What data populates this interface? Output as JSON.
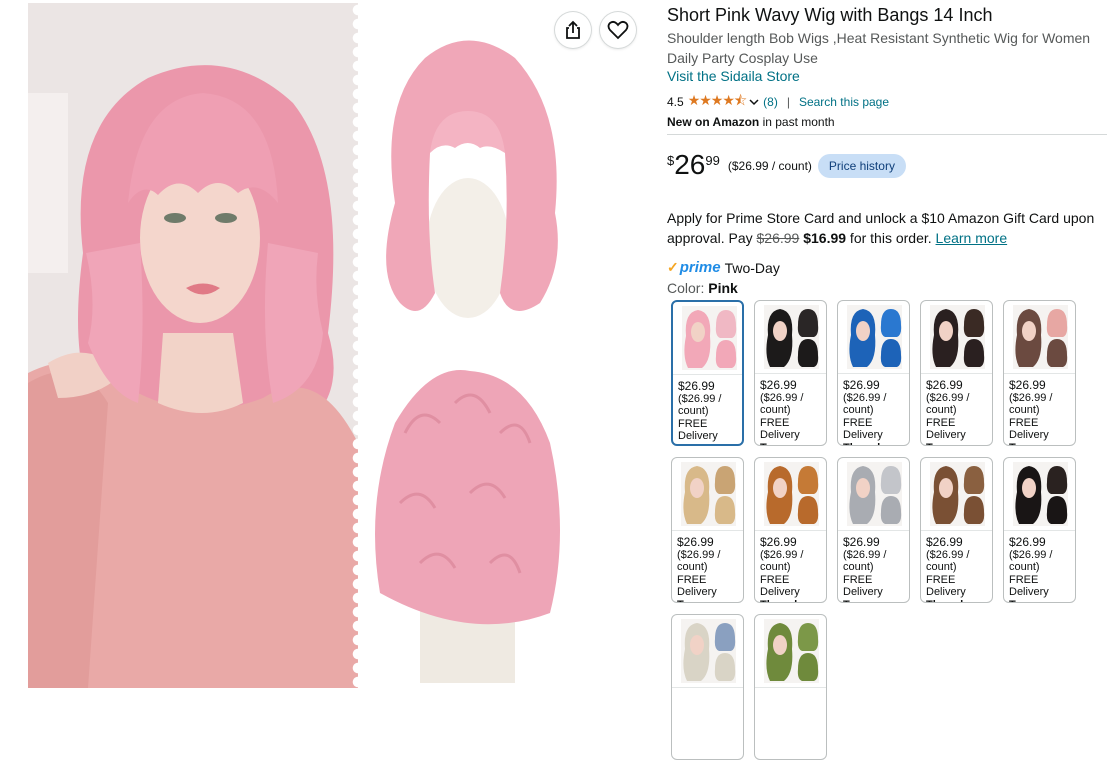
{
  "product": {
    "title": "Short Pink Wavy Wig with Bangs 14 Inch",
    "subtitle": "Shoulder length Bob Wigs ,Heat Resistant Synthetic Wig for Women Daily Party Cosplay Use",
    "store_link": "Visit the Sidaila Store",
    "rating_value": "4.5",
    "stars": "★★★★⯪",
    "rating_count": "(8)",
    "search_page": "Search this page",
    "badge_bold": "New on Amazon",
    "badge_rest": " in past month"
  },
  "price": {
    "currency": "$",
    "whole": "26",
    "fraction": "99",
    "unit": "($26.99 / count)",
    "history_button": "Price history"
  },
  "promo": {
    "text1": "Apply for Prime Store Card and unlock a $10 Amazon Gift Card upon approval. Pay ",
    "old_price": "$26.99",
    "new_price": "$16.99",
    "text2": " for this order. ",
    "learn_more": "Learn more"
  },
  "shipping": {
    "prime_check": "✓",
    "prime_label": "prime",
    "speed": "Two-Day"
  },
  "color": {
    "label": "Color: ",
    "value": "Pink"
  },
  "swatches": [
    {
      "price": "$26.99",
      "unit": "($26.99 / count)",
      "shipping": "FREE Delivery",
      "day": "Thursday",
      "hair": "#f2a8b8",
      "hair2": "#f0b8c4"
    },
    {
      "price": "$26.99",
      "unit": "($26.99 / count)",
      "shipping": "FREE Delivery",
      "day": "Tomorrow",
      "hair": "#1c1a1a",
      "hair2": "#2a2626"
    },
    {
      "price": "$26.99",
      "unit": "($26.99 / count)",
      "shipping": "FREE Delivery",
      "day": "Thursday",
      "hair": "#1d63b8",
      "hair2": "#2a78d0"
    },
    {
      "price": "$26.99",
      "unit": "($26.99 / count)",
      "shipping": "FREE Delivery",
      "day": "Tomorrow",
      "hair": "#2a2020",
      "hair2": "#3a2a24"
    },
    {
      "price": "$26.99",
      "unit": "($26.99 / count)",
      "shipping": "FREE Delivery",
      "day": "Tomorrow",
      "hair": "#6b4a40",
      "hair2": "#e7a7a3"
    },
    {
      "price": "$26.99",
      "unit": "($26.99 / count)",
      "shipping": "FREE Delivery",
      "day": "Tomorrow",
      "hair": "#d8b989",
      "hair2": "#c9a474"
    },
    {
      "price": "$26.99",
      "unit": "($26.99 / count)",
      "shipping": "FREE Delivery",
      "day": "Thursday",
      "hair": "#b86a2c",
      "hair2": "#c57a36"
    },
    {
      "price": "$26.99",
      "unit": "($26.99 / count)",
      "shipping": "FREE Delivery",
      "day": "Tomorrow",
      "hair": "#a9acb2",
      "hair2": "#c3c5ca"
    },
    {
      "price": "$26.99",
      "unit": "($26.99 / count)",
      "shipping": "FREE Delivery",
      "day": "Thursday",
      "hair": "#7a5034",
      "hair2": "#8a6040"
    },
    {
      "price": "$26.99",
      "unit": "($26.99 / count)",
      "shipping": "FREE Delivery",
      "day": "Tomorrow",
      "hair": "#191515",
      "hair2": "#2a2220"
    },
    {
      "price": "",
      "unit": "",
      "shipping": "",
      "day": "",
      "hair": "#d9d4c6",
      "hair2": "#8aa0c0"
    },
    {
      "price": "",
      "unit": "",
      "shipping": "",
      "day": "",
      "hair": "#6f8a3c",
      "hair2": "#7c9848"
    }
  ],
  "colors": {
    "link": "#007185",
    "star": "#de7921",
    "selected_border": "#2a6fa8",
    "wig": "#f0a7b8"
  }
}
